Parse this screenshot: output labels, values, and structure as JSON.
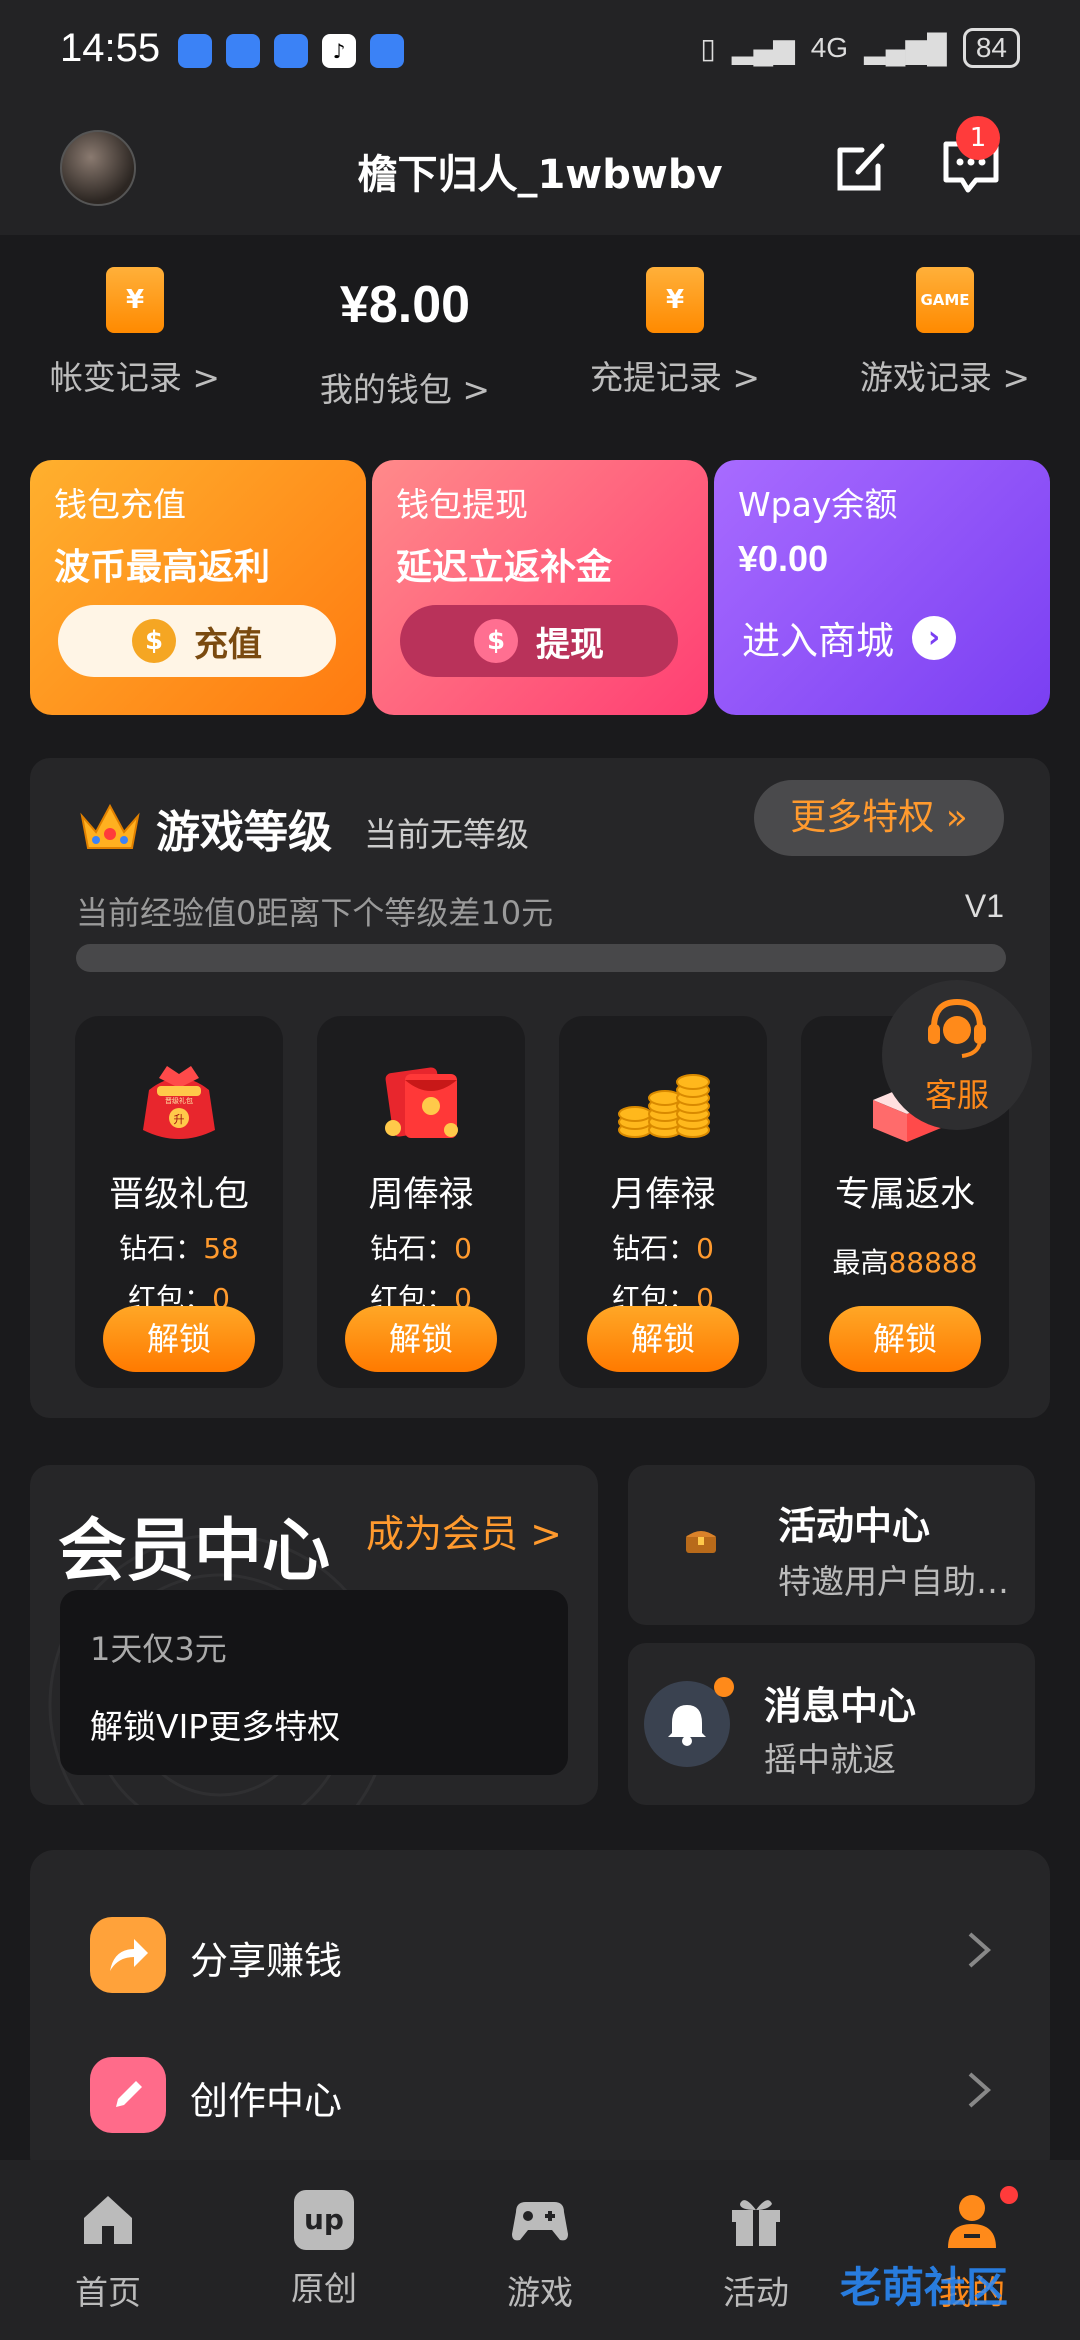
{
  "status": {
    "time": "14:55",
    "battery": "84",
    "network": "4G"
  },
  "header": {
    "username": "檐下归人_1wbwbv",
    "message_badge": "1"
  },
  "wallet": {
    "items": [
      {
        "icon": "¥",
        "label": "帐变记录 >"
      },
      {
        "amount": "¥8.00",
        "label": "我的钱包 >"
      },
      {
        "icon": "¥",
        "label": "充提记录 >"
      },
      {
        "icon": "GAME",
        "label": "游戏记录 >"
      }
    ]
  },
  "promos": [
    {
      "title": "钱包充值",
      "subtitle": "波币最高返利",
      "button": "充值",
      "coin": "$"
    },
    {
      "title": "钱包提现",
      "subtitle": "延迟立返补金",
      "button": "提现",
      "coin": "$"
    },
    {
      "title": "Wpay余额",
      "subtitle": "¥0.00",
      "button": "进入商城"
    }
  ],
  "level": {
    "title": "游戏等级",
    "current": "当前无等级",
    "more": "更多特权 »",
    "exp_text": "当前经验值0距离下个等级差10元",
    "next_level": "V1",
    "progress": 0
  },
  "perks": [
    {
      "name": "晋级礼包",
      "diamond_label": "钻石：",
      "diamond": "58",
      "redpack_label": "红包：",
      "redpack": "0",
      "button": "解锁",
      "badge_text": "晋级礼包",
      "badge_up": "升"
    },
    {
      "name": "周俸禄",
      "diamond_label": "钻石：",
      "diamond": "0",
      "redpack_label": "红包：",
      "redpack": "0",
      "button": "解锁"
    },
    {
      "name": "月俸禄",
      "diamond_label": "钻石：",
      "diamond": "0",
      "redpack_label": "红包：",
      "redpack": "0",
      "button": "解锁"
    },
    {
      "name": "专属返水",
      "max_label": "最高",
      "max_value": "88888",
      "button": "解锁"
    }
  ],
  "customer_service": {
    "label": "客服"
  },
  "vip": {
    "title": "会员中心",
    "link": "成为会员 >",
    "line1": "1天仅3元",
    "line2": "解锁VIP更多特权"
  },
  "activity": {
    "title": "活动中心",
    "subtitle": "特邀用户自助…"
  },
  "messages": {
    "title": "消息中心",
    "subtitle": "摇中就返"
  },
  "menu": [
    {
      "label": "分享赚钱",
      "icon": "share-icon"
    },
    {
      "label": "创作中心",
      "icon": "pencil-icon"
    }
  ],
  "nav": [
    {
      "label": "首页",
      "icon": "home-icon"
    },
    {
      "label": "原创",
      "icon": "up-icon",
      "icon_text": "up"
    },
    {
      "label": "游戏",
      "icon": "gamepad-icon"
    },
    {
      "label": "活动",
      "icon": "gift-icon"
    },
    {
      "label": "我的",
      "icon": "user-icon"
    }
  ],
  "watermark": "老萌社区",
  "colors": {
    "accent": "#ff9a2e",
    "background": "#1a1a1c",
    "card": "#262628",
    "badge": "#ff3b3b"
  }
}
